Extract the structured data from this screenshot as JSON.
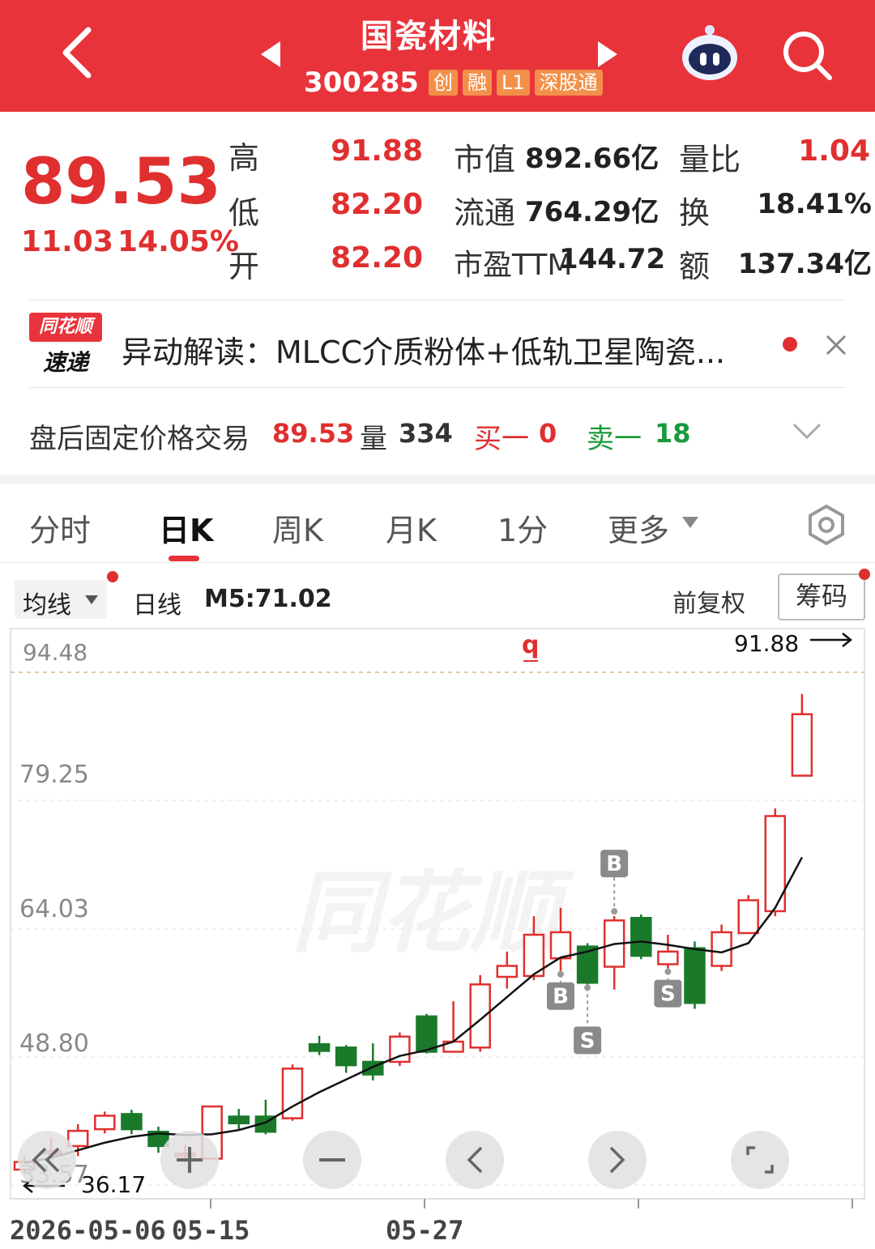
{
  "header": {
    "title": "国瓷材料",
    "code": "300285",
    "badges": [
      "创",
      "融",
      "L1",
      "深股通"
    ]
  },
  "quote": {
    "price": "89.53",
    "change": "11.03",
    "change_pct": "14.05%",
    "stats": [
      {
        "label": "高",
        "value": "91.88"
      },
      {
        "label": "低",
        "value": "82.20"
      },
      {
        "label": "开",
        "value": "82.20"
      }
    ],
    "market": [
      {
        "label": "市值",
        "value": "892.66亿"
      },
      {
        "label": "流通",
        "value": "764.29亿"
      },
      {
        "label": "市盈TTM",
        "value": "144.72"
      }
    ],
    "ratios": [
      {
        "label": "量比",
        "value": "1.04"
      },
      {
        "label": "换",
        "value": "18.41%"
      },
      {
        "label": "额",
        "value": "137.34亿"
      }
    ]
  },
  "news": {
    "logo_top": "同花顺",
    "logo_bottom": "速递",
    "text": "异动解读：MLCC介质粉体+低轨卫星陶瓷..."
  },
  "after_hours": {
    "label": "盘后固定价格交易",
    "price": "89.53",
    "volume_label": "量",
    "volume": "334",
    "buy_label": "买一",
    "buy": "0",
    "sell_label": "卖一",
    "sell": "18"
  },
  "tabs": [
    "分时",
    "日K",
    "周K",
    "月K",
    "1分",
    "更多"
  ],
  "active_tab": "日K",
  "chart_toolbar": {
    "indicator": "均线",
    "period": "日线",
    "ma": "M5:71.02",
    "adjust": "前复权",
    "chips": "筹码"
  },
  "colors": {
    "up": "#e02f2f",
    "down": "#1a7a2a",
    "accent": "#e8333b",
    "ma": "#111111"
  },
  "chart_data": {
    "type": "candlestick",
    "y_ticks": [
      "94.48",
      "79.25",
      "64.03",
      "48.80",
      "33.57"
    ],
    "high_label": "91.88",
    "low_label": "36.17",
    "x_labels": [
      "2026-05-06",
      "05-15",
      "05-27"
    ],
    "ylim": [
      33.57,
      94.48
    ],
    "candles": [
      {
        "o": 35.4,
        "c": 36.3,
        "h": 37.0,
        "l": 35.0
      },
      {
        "o": 37.5,
        "c": 37.6,
        "h": 39.2,
        "l": 37.2
      },
      {
        "o": 38.2,
        "c": 40.0,
        "h": 40.8,
        "l": 37.0
      },
      {
        "o": 40.2,
        "c": 41.8,
        "h": 42.3,
        "l": 39.7
      },
      {
        "o": 42.0,
        "c": 40.2,
        "h": 42.5,
        "l": 39.6
      },
      {
        "o": 39.9,
        "c": 38.2,
        "h": 40.5,
        "l": 37.4
      },
      {
        "o": 37.2,
        "c": 37.3,
        "h": 38.4,
        "l": 36.2
      },
      {
        "o": 36.7,
        "c": 42.9,
        "h": 43.0,
        "l": 36.7
      },
      {
        "o": 41.7,
        "c": 40.9,
        "h": 42.6,
        "l": 40.2
      },
      {
        "o": 41.7,
        "c": 39.9,
        "h": 43.7,
        "l": 39.6
      },
      {
        "o": 41.5,
        "c": 47.4,
        "h": 47.9,
        "l": 41.2
      },
      {
        "o": 50.3,
        "c": 49.5,
        "h": 51.3,
        "l": 49.0
      },
      {
        "o": 49.9,
        "c": 47.8,
        "h": 50.2,
        "l": 46.9
      },
      {
        "o": 48.2,
        "c": 46.7,
        "h": 50.4,
        "l": 46.0
      },
      {
        "o": 48.2,
        "c": 51.2,
        "h": 51.7,
        "l": 47.7
      },
      {
        "o": 53.6,
        "c": 49.4,
        "h": 53.9,
        "l": 49.2
      },
      {
        "o": 49.4,
        "c": 50.6,
        "h": 55.4,
        "l": 49.3
      },
      {
        "o": 49.9,
        "c": 57.4,
        "h": 58.5,
        "l": 49.4
      },
      {
        "o": 58.3,
        "c": 59.6,
        "h": 61.3,
        "l": 56.9
      },
      {
        "o": 58.4,
        "c": 63.3,
        "h": 65.5,
        "l": 57.9
      },
      {
        "o": 60.5,
        "c": 63.6,
        "h": 66.5,
        "l": 59.0
      },
      {
        "o": 61.9,
        "c": 57.6,
        "h": 62.3,
        "l": 57.4
      },
      {
        "o": 59.5,
        "c": 65.0,
        "h": 65.5,
        "l": 56.8
      },
      {
        "o": 65.3,
        "c": 60.8,
        "h": 65.7,
        "l": 60.4
      },
      {
        "o": 59.8,
        "c": 61.3,
        "h": 63.3,
        "l": 59.3
      },
      {
        "o": 61.7,
        "c": 55.2,
        "h": 62.5,
        "l": 54.5
      },
      {
        "o": 59.6,
        "c": 63.6,
        "h": 64.5,
        "l": 59.0
      },
      {
        "o": 63.5,
        "c": 67.4,
        "h": 68.0,
        "l": 63.4
      },
      {
        "o": 66.1,
        "c": 77.4,
        "h": 78.3,
        "l": 65.5
      },
      {
        "o": 82.2,
        "c": 89.5,
        "h": 91.9,
        "l": 82.2
      }
    ],
    "ma5": [
      36.2,
      36.8,
      37.7,
      38.6,
      39.3,
      39.7,
      39.5,
      39.6,
      40.1,
      41.0,
      42.9,
      44.6,
      46.1,
      47.6,
      48.9,
      49.6,
      50.6,
      53.2,
      55.9,
      58.6,
      60.6,
      61.3,
      62.2,
      62.5,
      62.1,
      61.6,
      61.2,
      62.3,
      66.5,
      72.5
    ],
    "markers": [
      {
        "label": "B",
        "index": 22,
        "pos": "above"
      },
      {
        "label": "B",
        "index": 20,
        "pos": "below"
      },
      {
        "label": "S",
        "index": 21,
        "pos": "below"
      },
      {
        "label": "S",
        "index": 24,
        "pos": "below"
      }
    ],
    "watermark": "同花顺"
  }
}
